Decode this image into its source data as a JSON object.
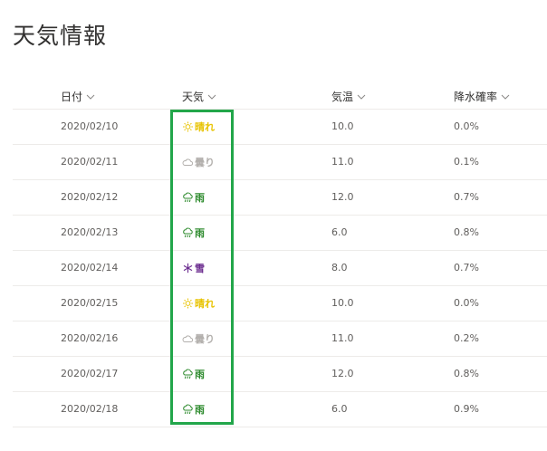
{
  "page": {
    "title": "天気情報"
  },
  "columns": [
    {
      "key": "date",
      "label": "日付"
    },
    {
      "key": "weather",
      "label": "天気"
    },
    {
      "key": "temp",
      "label": "気温"
    },
    {
      "key": "rain",
      "label": "降水確率"
    }
  ],
  "weather_styles": {
    "晴れ": {
      "color": "#e8c300",
      "icon": "sun-icon"
    },
    "曇り": {
      "color": "#b3b0ad",
      "icon": "cloud-icon"
    },
    "雨": {
      "color": "#2e8b2e",
      "icon": "rain-icon"
    },
    "雪": {
      "color": "#6b2c8f",
      "icon": "snow-icon"
    }
  },
  "rows": [
    {
      "date": "2020/02/10",
      "weather": "晴れ",
      "temp": "10.0",
      "rain": "0.0%"
    },
    {
      "date": "2020/02/11",
      "weather": "曇り",
      "temp": "11.0",
      "rain": "0.1%"
    },
    {
      "date": "2020/02/12",
      "weather": "雨",
      "temp": "12.0",
      "rain": "0.7%"
    },
    {
      "date": "2020/02/13",
      "weather": "雨",
      "temp": "6.0",
      "rain": "0.8%"
    },
    {
      "date": "2020/02/14",
      "weather": "雪",
      "temp": "8.0",
      "rain": "0.7%"
    },
    {
      "date": "2020/02/15",
      "weather": "晴れ",
      "temp": "10.0",
      "rain": "0.0%"
    },
    {
      "date": "2020/02/16",
      "weather": "曇り",
      "temp": "11.0",
      "rain": "0.2%"
    },
    {
      "date": "2020/02/17",
      "weather": "雨",
      "temp": "12.0",
      "rain": "0.8%"
    },
    {
      "date": "2020/02/18",
      "weather": "雨",
      "temp": "6.0",
      "rain": "0.9%"
    }
  ],
  "highlight": {
    "color": "#22a64a"
  }
}
